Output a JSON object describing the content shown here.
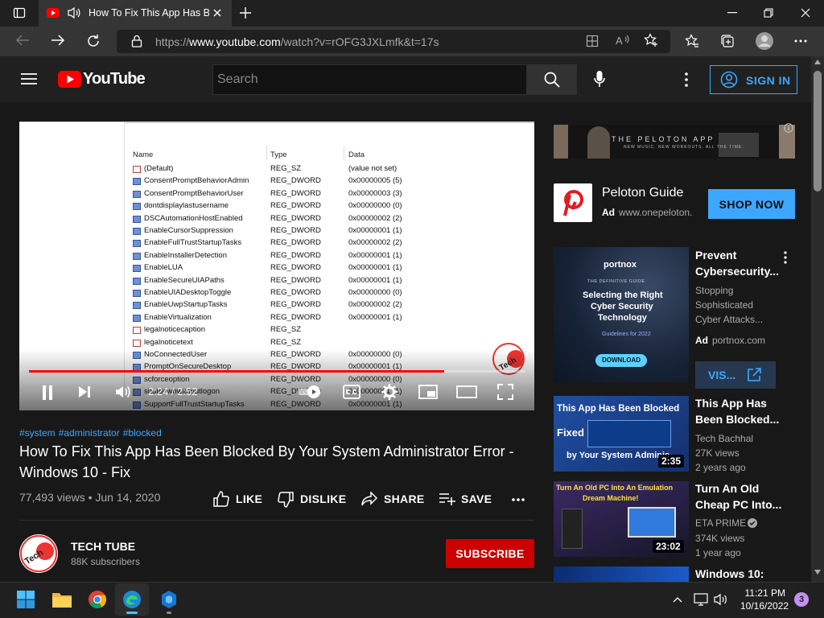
{
  "browser": {
    "tab_title": "How To Fix This App Has Been Blocked By Your System Administrator Error",
    "url_prefix": "https://",
    "url_host": "www.youtube.com",
    "url_path": "/watch?v=rOFG3JXLmfk&t=17s"
  },
  "header": {
    "logo_text": "YouTube",
    "search_placeholder": "Search",
    "signin_label": "SIGN IN"
  },
  "video": {
    "registry_columns": [
      "Name",
      "Type",
      "Data"
    ],
    "registry_rows": [
      {
        "name": "(Default)",
        "type": "REG_SZ",
        "data": "(value not set)",
        "kind": "sz"
      },
      {
        "name": "ConsentPromptBehaviorAdmin",
        "type": "REG_DWORD",
        "data": "0x00000005 (5)",
        "kind": "dw"
      },
      {
        "name": "ConsentPromptBehaviorUser",
        "type": "REG_DWORD",
        "data": "0x00000003 (3)",
        "kind": "dw"
      },
      {
        "name": "dontdisplaylastusername",
        "type": "REG_DWORD",
        "data": "0x00000000 (0)",
        "kind": "dw"
      },
      {
        "name": "DSCAutomationHostEnabled",
        "type": "REG_DWORD",
        "data": "0x00000002 (2)",
        "kind": "dw"
      },
      {
        "name": "EnableCursorSuppression",
        "type": "REG_DWORD",
        "data": "0x00000001 (1)",
        "kind": "dw"
      },
      {
        "name": "EnableFullTrustStartupTasks",
        "type": "REG_DWORD",
        "data": "0x00000002 (2)",
        "kind": "dw"
      },
      {
        "name": "EnableInstallerDetection",
        "type": "REG_DWORD",
        "data": "0x00000001 (1)",
        "kind": "dw"
      },
      {
        "name": "EnableLUA",
        "type": "REG_DWORD",
        "data": "0x00000001 (1)",
        "kind": "dw"
      },
      {
        "name": "EnableSecureUIAPaths",
        "type": "REG_DWORD",
        "data": "0x00000001 (1)",
        "kind": "dw"
      },
      {
        "name": "EnableUIADesktopToggle",
        "type": "REG_DWORD",
        "data": "0x00000000 (0)",
        "kind": "dw"
      },
      {
        "name": "EnableUwpStartupTasks",
        "type": "REG_DWORD",
        "data": "0x00000002 (2)",
        "kind": "dw"
      },
      {
        "name": "EnableVirtualization",
        "type": "REG_DWORD",
        "data": "0x00000001 (1)",
        "kind": "dw"
      },
      {
        "name": "legalnoticecaption",
        "type": "REG_SZ",
        "data": "",
        "kind": "sz"
      },
      {
        "name": "legalnoticetext",
        "type": "REG_SZ",
        "data": "",
        "kind": "sz"
      },
      {
        "name": "NoConnectedUser",
        "type": "REG_DWORD",
        "data": "0x00000000 (0)",
        "kind": "dw"
      },
      {
        "name": "PromptOnSecureDesktop",
        "type": "REG_DWORD",
        "data": "0x00000001 (1)",
        "kind": "dw"
      },
      {
        "name": "scforceoption",
        "type": "REG_DWORD",
        "data": "0x00000000 (0)",
        "kind": "dw"
      },
      {
        "name": "shutdownwithoutlogon",
        "type": "REG_DWORD",
        "data": "0x00000001 (1)",
        "kind": "dw"
      },
      {
        "name": "SupportFullTrustStartupTasks",
        "type": "REG_DWORD",
        "data": "0x00000001 (1)",
        "kind": "dw"
      }
    ],
    "current_time": "2:24 / 2:52",
    "progress_fraction": 0.837,
    "hashtags": [
      "#system",
      "#administrator",
      "#blocked"
    ],
    "title": "How To Fix This App Has Been Blocked By Your System Administrator Error - Windows 10 - Fix",
    "views_date": "77,493 views • Jun 14, 2020",
    "like_label": "LIKE",
    "dislike_label": "DISLIKE",
    "share_label": "SHARE",
    "save_label": "SAVE"
  },
  "channel": {
    "name": "TECH TUBE",
    "subscribers": "88K subscribers",
    "subscribe_label": "SUBSCRIBE"
  },
  "sidebar": {
    "banner_text": "THE PELOTON APP",
    "banner_subtext": "NEW MUSIC. NEW WORKOUTS. ALL THE TIME.",
    "ad1": {
      "title": "Peloton Guide",
      "ad_label": "Ad",
      "url": "www.onepeloton.",
      "button": "SHOP NOW"
    },
    "ad2": {
      "title": "Prevent Cybersecurity...",
      "desc": [
        "Stopping",
        "Sophisticated",
        "Cyber Attacks..."
      ],
      "ad_label": "Ad",
      "url": "portnox.com",
      "button": "VIS...",
      "thumb_brand": "portnox",
      "thumb_kicker": "THE DEFINITIVE GUIDE",
      "thumb_lines": [
        "Selecting the Right",
        "Cyber Security",
        "Technology"
      ],
      "thumb_guide": "Guidelines for 2022",
      "thumb_download": "DOWNLOAD"
    },
    "videos": [
      {
        "title": "This App Has Been Blocked...",
        "channel": "Tech Bachhal",
        "views": "27K views",
        "age": "2 years ago",
        "duration": "2:35",
        "thumb_lines": [
          "This App Has Been Blocked",
          "Fixed",
          "by Your System Adminis"
        ]
      },
      {
        "title": "Turn An Old Cheap PC Into...",
        "channel": "ETA PRIME",
        "views": "374K views",
        "age": "1 year ago",
        "duration": "23:02",
        "thumb_lines": [
          "Turn An Old PC Into An Emulation",
          "Dream Machine!"
        ]
      },
      {
        "title": "Windows 10:"
      }
    ]
  },
  "taskbar": {
    "time": "11:21 PM",
    "date": "10/16/2022",
    "notification_count": "3"
  }
}
